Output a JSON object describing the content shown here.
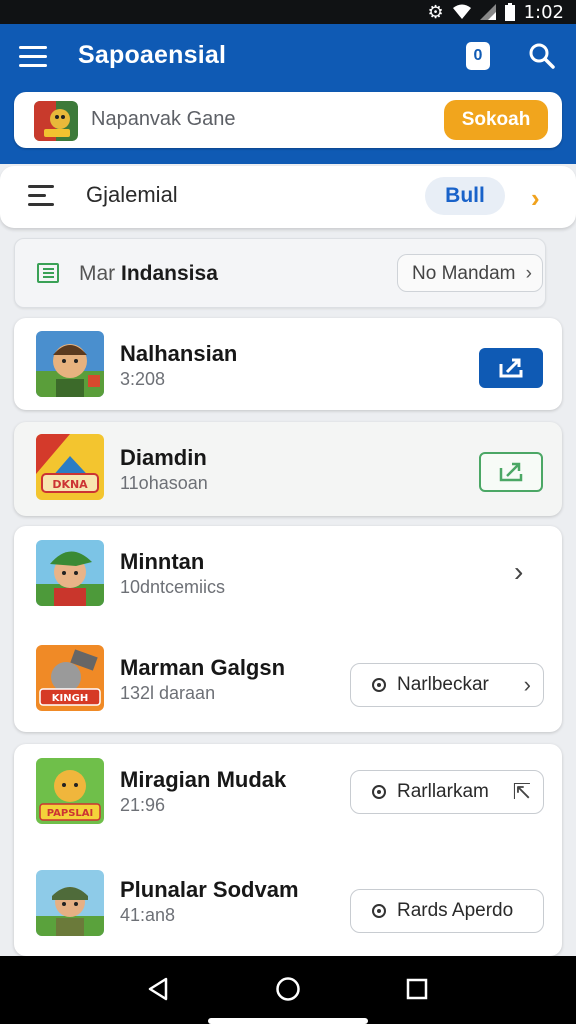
{
  "status": {
    "time": "1:02"
  },
  "appbar": {
    "title": "Sapoaensial",
    "badge": "0"
  },
  "search": {
    "query": "Napanvak Gane",
    "button": "Sokoah"
  },
  "filter": {
    "title": "Gjalemial",
    "chip": "Bull"
  },
  "section": {
    "prefix": "Mar ",
    "title": "Indansisa",
    "button": "No Mandam"
  },
  "items": [
    {
      "name": "Nalhansian",
      "meta": "3:208",
      "action": "download-primary"
    },
    {
      "name": "Diamdin",
      "meta": "11ohasoan",
      "action": "download-outline"
    },
    {
      "name": "Minntan",
      "meta": "10dntcemiics",
      "action": "chevron"
    },
    {
      "name": "Marman Galgsn",
      "meta": "132l daraan",
      "action": "Narlbeckar"
    },
    {
      "name": "Miragian Mudak",
      "meta": "21:96",
      "action": "Rarllarkam"
    },
    {
      "name": "Plunalar Sodvam",
      "meta": "41:an8",
      "action": "Rards Aperdo"
    }
  ],
  "colors": {
    "primary": "#0f5ab4",
    "accent": "#f1a51d",
    "success": "#4ba765"
  }
}
